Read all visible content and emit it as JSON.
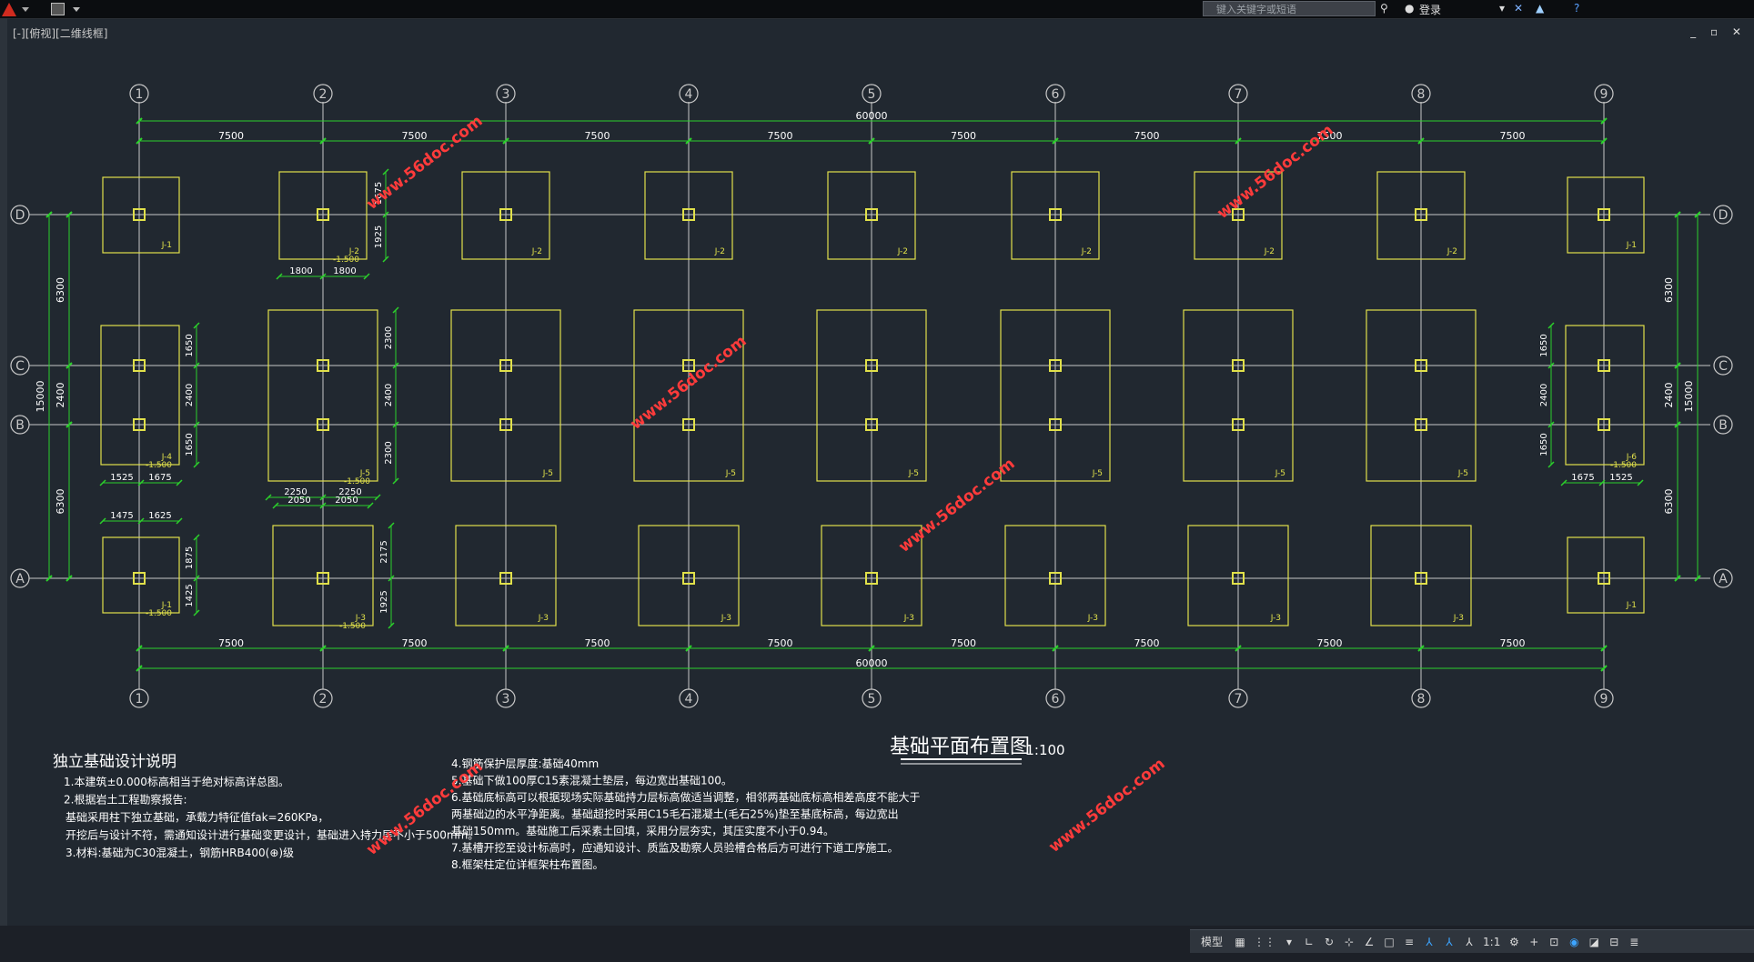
{
  "titlebar": {
    "search_placeholder": "键入关键字或短语",
    "login_label": "登录"
  },
  "viewport": {
    "label": "[-][俯视][二维线框]",
    "win_controls": "_ ▫ ✕"
  },
  "drawing": {
    "title": "基础平面布置图",
    "scale": "1:100",
    "grid_columns": [
      "1",
      "2",
      "3",
      "4",
      "5",
      "6",
      "7",
      "8",
      "9"
    ],
    "grid_rows": [
      "D",
      "C",
      "B",
      "A"
    ],
    "bay_dim": "7500",
    "total_length": "60000",
    "total_width": "15000",
    "side_dims": [
      "6300",
      "2400",
      "6300"
    ],
    "footing_tags": {
      "top": [
        "J-1",
        "J-2",
        "J-2",
        "J-2",
        "J-2",
        "J-2",
        "J-2",
        "J-2",
        "J-1"
      ],
      "mid": [
        "J-4",
        "J-5",
        "J-5",
        "J-5",
        "J-5",
        "J-5",
        "J-5",
        "J-5",
        "J-6"
      ],
      "bot": [
        "J-1",
        "J-3",
        "J-3",
        "J-3",
        "J-3",
        "J-3",
        "J-3",
        "J-3",
        "J-1"
      ]
    },
    "elev": "-1.500",
    "dims": {
      "j2_h": [
        "1675",
        "1925"
      ],
      "j2_w": [
        "1800",
        "1800"
      ],
      "j4_h": [
        "1650",
        "2400",
        "1650"
      ],
      "j4_w": [
        "1525",
        "1675"
      ],
      "j5_h": [
        "2300",
        "2400",
        "2300"
      ],
      "j5_w_outer": [
        "2250",
        "2250"
      ],
      "j5_w_inner": [
        "2050",
        "2050"
      ],
      "j1_w": [
        "1475",
        "1625"
      ],
      "j1_h": [
        "1875",
        "1425"
      ],
      "j3_h": [
        "2175",
        "1925"
      ],
      "j6_w": [
        "1675",
        "1525"
      ]
    },
    "watermark": "www.56doc.com"
  },
  "notes": {
    "heading": "独立基础设计说明",
    "left": [
      "1.本建筑±0.000标高相当于绝对标高详总图。",
      "2.根据岩土工程勘察报告:",
      "基础采用柱下独立基础，承载力特征值fak=260KPa，",
      "开挖后与设计不符，需通知设计进行基础变更设计，基础进入持力层不小于500mm。",
      "3.材料:基础为C30混凝土，钢筋HRB400(⊕)级"
    ],
    "right": [
      "4.钢筋保护层厚度:基础40mm",
      "5.基础下做100厚C15素混凝土垫层，每边宽出基础100。",
      "6.基础底标高可以根据现场实际基础持力层标高做适当调整，相邻两基础底标高相差高度不能大于",
      "两基础边的水平净距离。基础超挖时采用C15毛石混凝土(毛石25%)垫至基底标高，每边宽出",
      "基础150mm。基础施工后采素土回填，采用分层夯实，其压实度不小于0.94。",
      "7.基槽开挖至设计标高时，应通知设计、质监及勘察人员验槽合格后方可进行下道工序施工。",
      "8.框架柱定位详框架柱布置图。"
    ]
  },
  "statusbar": {
    "model_label": "模型",
    "scale_label": "1:1"
  },
  "colors": {
    "background": "#212830",
    "axis": "#c8c8c8",
    "dimension": "#2bd12b",
    "footing": "#e0e04a",
    "watermark": "#ff3b3b",
    "text": "#ffffff"
  }
}
